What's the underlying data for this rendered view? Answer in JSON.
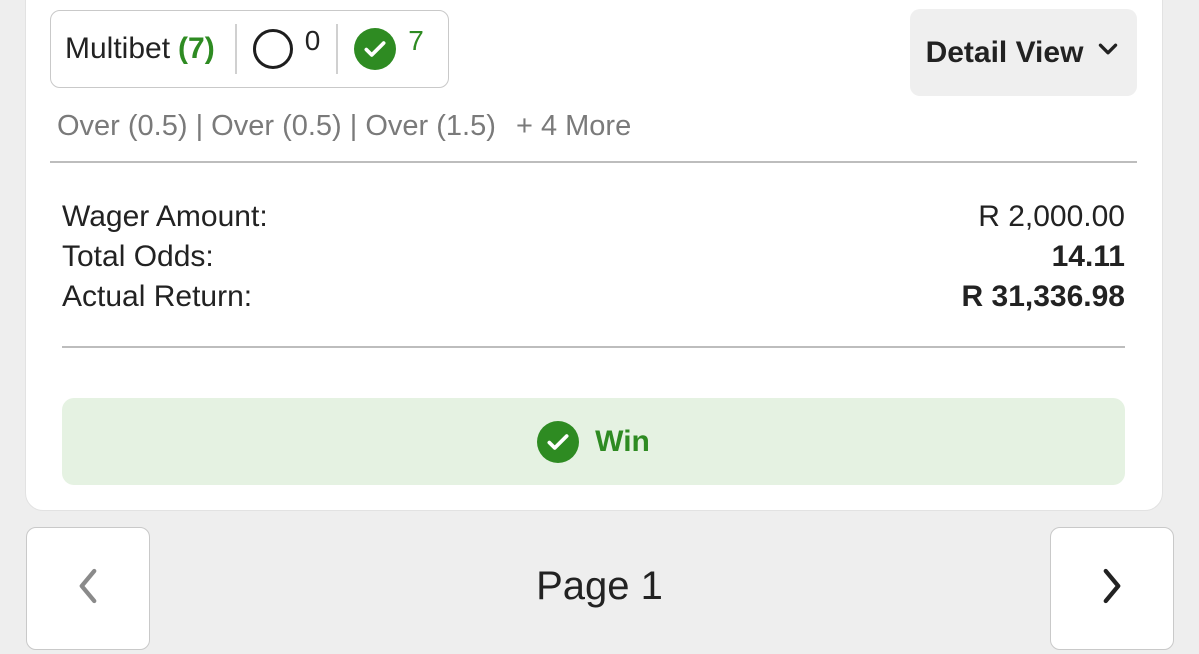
{
  "bet_card": {
    "summary": {
      "type_label": "Multibet",
      "count_label": "(7)",
      "open_count": "0",
      "won_count": "7"
    },
    "detail_button_label": "Detail View",
    "selections": {
      "text": "Over (0.5) | Over (0.5) | Over (1.5)",
      "more_label": "+ 4 More"
    },
    "details": {
      "wager_label": "Wager Amount:",
      "wager_value": "R 2,000.00",
      "odds_label": "Total Odds:",
      "odds_value": "14.11",
      "return_label": "Actual Return:",
      "return_value": "R 31,336.98"
    },
    "result": {
      "label": "Win",
      "color": "#2e8b22",
      "background": "#e5f2e2"
    }
  },
  "pagination": {
    "page_label": "Page 1",
    "prev_icon": "chevron-left-icon",
    "next_icon": "chevron-right-icon"
  }
}
